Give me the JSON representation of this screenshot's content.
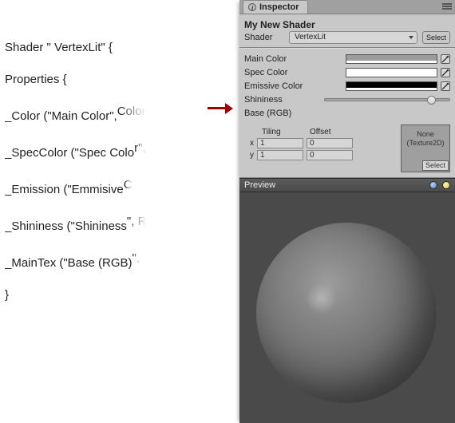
{
  "code": {
    "l1": "Shader \" VertexLit\" {",
    "l2": "   Properties {",
    "l3a": "       _Color (\"Main Color\",",
    "l3b": " Color",
    "l4a": "       _SpecColor (\"Spec Colo",
    "l4b": "r\",",
    "l5a": "       _Emission (\"Emmisive",
    "l5b": " C",
    "l6a": "       _Shininess (\"Shininess",
    "l6b": "\", R",
    "l7a": "       _MainTex (\"Base (RGB)",
    "l7b": "\",",
    "l8": "   }"
  },
  "inspector": {
    "tab": "Inspector",
    "material_name": "My New Shader",
    "shader_label": "Shader",
    "shader_value": "VertexLit",
    "select_label": "Select",
    "props": {
      "main_color_label": "Main Color",
      "spec_color_label": "Spec Color",
      "emissive_color_label": "Emissive Color",
      "shininess_label": "Shininess",
      "base_label": "Base (RGB)"
    },
    "colors": {
      "main": "#9c9c9c",
      "spec": "#ffffff",
      "emiss": "#000000"
    },
    "shininess": 0.82,
    "texture": {
      "none_label": "None",
      "type_label": "(Texture2D)",
      "select_label": "Select",
      "tiling_label": "Tiling",
      "offset_label": "Offset",
      "x_tiling": "1",
      "y_tiling": "1",
      "x_offset": "0",
      "y_offset": "0"
    },
    "preview_label": "Preview"
  }
}
